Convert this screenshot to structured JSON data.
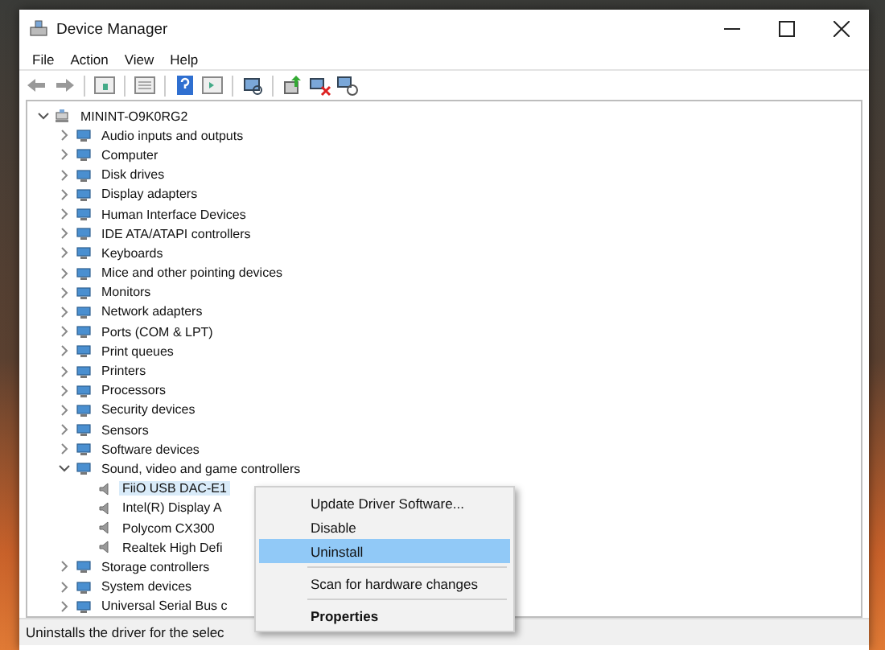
{
  "window": {
    "title": "Device Manager"
  },
  "menu": [
    "File",
    "Action",
    "View",
    "Help"
  ],
  "tree": {
    "label": "MININT-O9K0RG2",
    "expanded": true,
    "children": [
      {
        "label": "Audio inputs and outputs",
        "expanded": false
      },
      {
        "label": "Computer",
        "expanded": false
      },
      {
        "label": "Disk drives",
        "expanded": false
      },
      {
        "label": "Display adapters",
        "expanded": false
      },
      {
        "label": "Human Interface Devices",
        "expanded": false
      },
      {
        "label": "IDE ATA/ATAPI controllers",
        "expanded": false
      },
      {
        "label": "Keyboards",
        "expanded": false
      },
      {
        "label": "Mice and other pointing devices",
        "expanded": false
      },
      {
        "label": "Monitors",
        "expanded": false
      },
      {
        "label": "Network adapters",
        "expanded": false
      },
      {
        "label": "Ports (COM & LPT)",
        "expanded": false
      },
      {
        "label": "Print queues",
        "expanded": false
      },
      {
        "label": "Printers",
        "expanded": false
      },
      {
        "label": "Processors",
        "expanded": false
      },
      {
        "label": "Security devices",
        "expanded": false
      },
      {
        "label": "Sensors",
        "expanded": false
      },
      {
        "label": "Software devices",
        "expanded": false
      },
      {
        "label": "Sound, video and game controllers",
        "expanded": true,
        "children": [
          {
            "label": "FiiO USB DAC-E1",
            "selected": true
          },
          {
            "label": "Intel(R) Display A",
            "selected": false
          },
          {
            "label": "Polycom CX300",
            "selected": false
          },
          {
            "label": "Realtek High Defi",
            "selected": false
          }
        ]
      },
      {
        "label": "Storage controllers",
        "expanded": false
      },
      {
        "label": "System devices",
        "expanded": false
      },
      {
        "label": "Universal Serial Bus c",
        "expanded": false
      }
    ]
  },
  "context_menu": {
    "items": [
      {
        "kind": "item",
        "label": "Update Driver Software...",
        "selected": false,
        "default": false
      },
      {
        "kind": "item",
        "label": "Disable",
        "selected": false,
        "default": false
      },
      {
        "kind": "item",
        "label": "Uninstall",
        "selected": true,
        "default": false
      },
      {
        "kind": "separator"
      },
      {
        "kind": "item",
        "label": "Scan for hardware changes",
        "selected": false,
        "default": false
      },
      {
        "kind": "separator"
      },
      {
        "kind": "item",
        "label": "Properties",
        "selected": false,
        "default": true
      }
    ]
  },
  "status_bar": {
    "text": "Uninstalls the driver for the selec"
  }
}
